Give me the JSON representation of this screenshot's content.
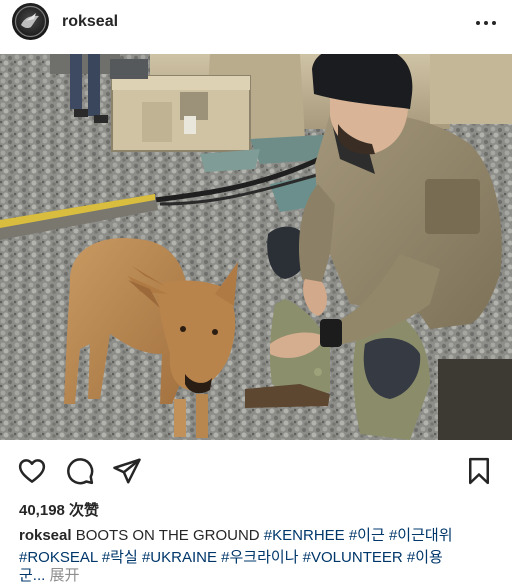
{
  "post": {
    "username": "rokseal",
    "likes": "40,198 次赞",
    "caption": {
      "username": "rokseal",
      "text": "BOOTS ON THE GROUND",
      "tags": [
        "#KENRHEE",
        "#이근",
        "#이근대위",
        "#ROKSEAL",
        "#락실",
        "#UKRAINE",
        "#우크라이나",
        "#VOLUNTEER",
        "#이용"
      ],
      "last_fragment": "군...",
      "expand_label": "展开"
    }
  },
  "icons": {
    "more": "more-horizontal-icon",
    "like": "heart-icon",
    "comment": "comment-bubble-icon",
    "share": "paper-plane-icon",
    "save": "bookmark-icon"
  }
}
